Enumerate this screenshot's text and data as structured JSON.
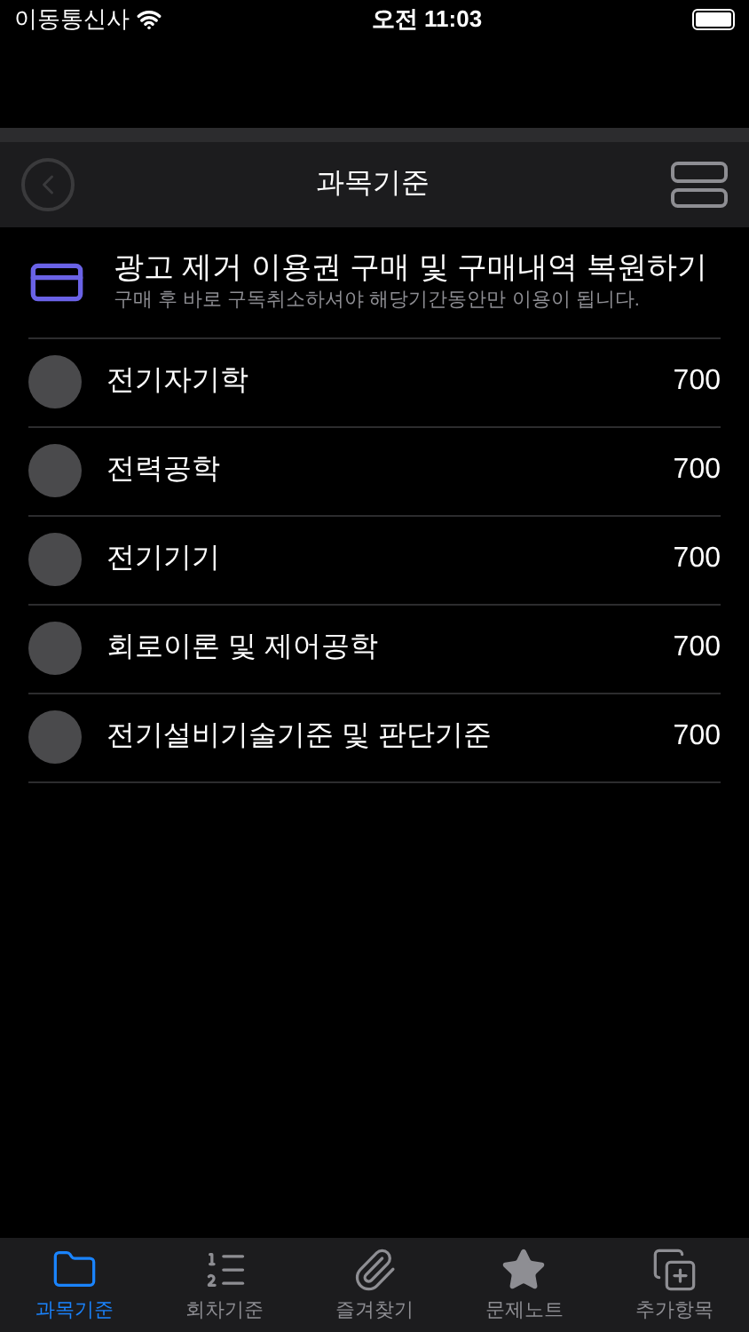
{
  "status_bar": {
    "carrier": "이동통신사",
    "time": "오전 11:03"
  },
  "nav": {
    "title": "과목기준"
  },
  "promo": {
    "title": "광고 제거 이용권 구매 및 구매내역 복원하기",
    "subtitle": "구매 후 바로 구독취소하셔야 해당기간동안만 이용이 됩니다."
  },
  "subjects": [
    {
      "name": "전기자기학",
      "count": "700"
    },
    {
      "name": "전력공학",
      "count": "700"
    },
    {
      "name": "전기기기",
      "count": "700"
    },
    {
      "name": "회로이론 및 제어공학",
      "count": "700"
    },
    {
      "name": "전기설비기술기준 및 판단기준",
      "count": "700"
    }
  ],
  "tabs": [
    {
      "label": "과목기준",
      "kind": "folder",
      "selected": true
    },
    {
      "label": "회차기준",
      "kind": "list",
      "selected": false
    },
    {
      "label": "즐겨찾기",
      "kind": "clip",
      "selected": false
    },
    {
      "label": "문제노트",
      "kind": "star",
      "selected": false
    },
    {
      "label": "추가항목",
      "kind": "add",
      "selected": false
    }
  ]
}
